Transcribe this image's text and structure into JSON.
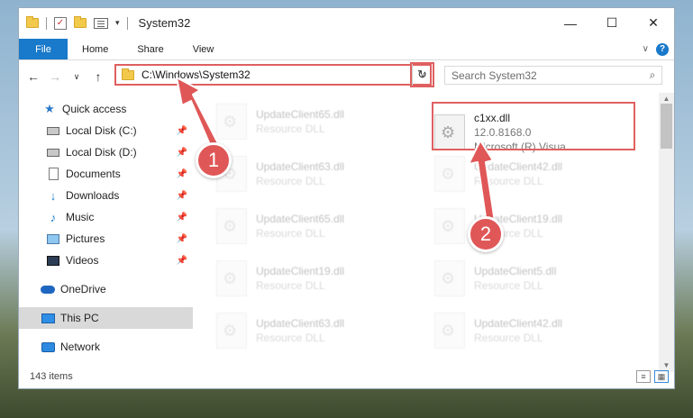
{
  "window": {
    "title": "System32",
    "minimize": "—",
    "maximize": "☐",
    "close": "✕"
  },
  "ribbon": {
    "tabs": [
      "File",
      "Home",
      "Share",
      "View"
    ],
    "expand": "∨",
    "help": "?"
  },
  "nav": {
    "back": "←",
    "forward": "→",
    "recent": "∨",
    "up": "↑",
    "address": "C:\\Windows\\System32",
    "address_dropdown": "∨",
    "refresh": "↻",
    "search_placeholder": "Search System32",
    "search_icon": "⌕"
  },
  "sidebar": {
    "items": [
      {
        "label": "Quick access",
        "icon": "star-icon",
        "pinned": false
      },
      {
        "label": "Local Disk (C:)",
        "icon": "drive-icon",
        "pinned": true
      },
      {
        "label": "Local Disk (D:)",
        "icon": "drive-icon",
        "pinned": true
      },
      {
        "label": "Documents",
        "icon": "documents-icon",
        "pinned": true
      },
      {
        "label": "Downloads",
        "icon": "downloads-icon",
        "pinned": true
      },
      {
        "label": "Music",
        "icon": "music-icon",
        "pinned": true
      },
      {
        "label": "Pictures",
        "icon": "pictures-icon",
        "pinned": true
      },
      {
        "label": "Videos",
        "icon": "videos-icon",
        "pinned": true
      },
      {
        "label": "OneDrive",
        "icon": "onedrive-icon",
        "pinned": false
      },
      {
        "label": "This PC",
        "icon": "this-pc-icon",
        "pinned": false,
        "selected": true
      },
      {
        "label": "Network",
        "icon": "network-icon",
        "pinned": false
      }
    ],
    "pin_glyph": "📌"
  },
  "files": {
    "left_column": [
      {
        "name": "UpdateClient65.dll",
        "type": "Resource DLL"
      },
      {
        "name": "UpdateClient63.dll",
        "type": "Resource DLL"
      },
      {
        "name": "UpdateClient65.dll",
        "type": "Resource DLL"
      },
      {
        "name": "UpdateClient19.dll",
        "type": "Resource DLL"
      },
      {
        "name": "UpdateClient63.dll",
        "type": "Resource DLL"
      }
    ],
    "right_column": [
      {
        "name": "c1xx.dll",
        "version": "12.0.8168.0",
        "type": "Microsoft (R) Visua..."
      },
      {
        "name": "UpdateClient42.dll",
        "type": "Resource DLL"
      },
      {
        "name": "UpdateClient19.dll",
        "type": "Resource DLL"
      },
      {
        "name": "UpdateClient5.dll",
        "type": "Resource DLL"
      },
      {
        "name": "UpdateClient42.dll",
        "type": "Resource DLL"
      }
    ]
  },
  "status": {
    "item_count": "143 items"
  },
  "callouts": [
    "1",
    "2"
  ],
  "colors": {
    "accent": "#1979ca",
    "highlight": "#e06060"
  }
}
